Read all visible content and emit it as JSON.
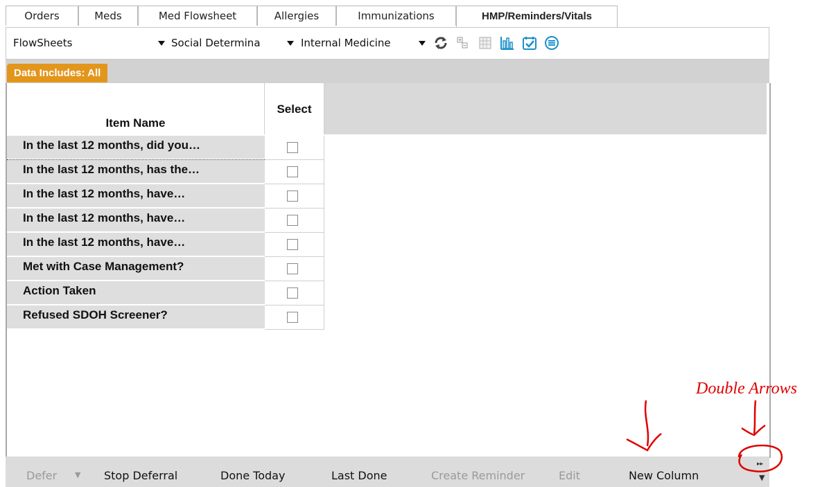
{
  "tabs": [
    "Orders",
    "Meds",
    "Med Flowsheet",
    "Allergies",
    "Immunizations",
    "HMP/Reminders/Vitals"
  ],
  "toolbar": {
    "combo1": "FlowSheets",
    "combo2": "Social Determina",
    "combo3": "Internal Medicine"
  },
  "badge": "Data Includes:  All",
  "grid": {
    "header_name": "Item Name",
    "header_select": "Select",
    "rows": [
      "In the last 12 months, did you…",
      "In the last 12 months, has the…",
      "In the last 12 months, have…",
      "In the last 12 months, have…",
      "In the last 12 months, have…",
      "Met with Case Management?",
      "Action Taken",
      "Refused SDOH Screener?"
    ]
  },
  "statusbar": {
    "defer": "Defer",
    "stop_deferral": "Stop Deferral",
    "done_today": "Done Today",
    "last_done": "Last Done",
    "create_reminder": "Create Reminder",
    "edit": "Edit",
    "new_column": "New Column"
  },
  "annotation": {
    "label": "Double Arrows",
    "color": "#e00000"
  },
  "colors": {
    "badge": "#e3961c",
    "icon_blue": "#1a8fc9"
  }
}
